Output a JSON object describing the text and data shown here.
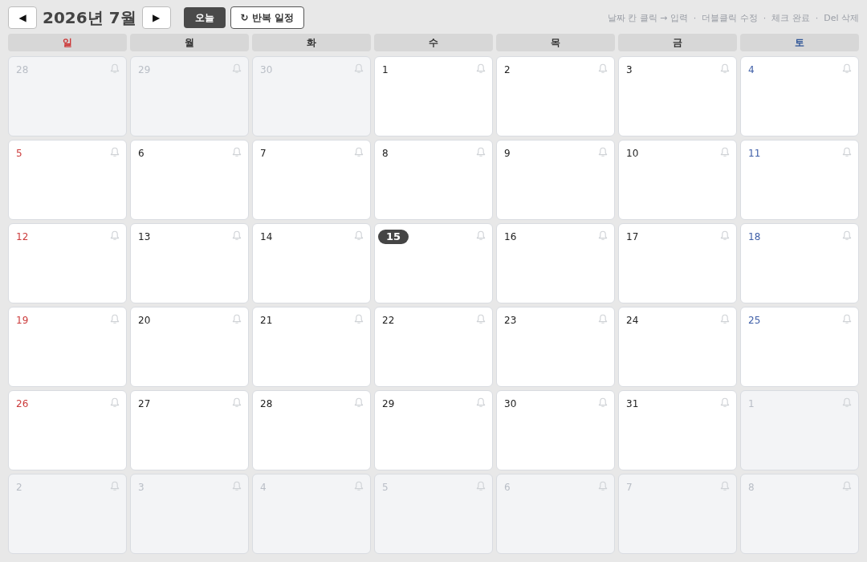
{
  "header": {
    "prev_label": "◀",
    "title": "2026년 7월",
    "next_label": "▶",
    "today_button": "오늘",
    "repeat_button": {
      "icon": "↻",
      "label": "반복 일정"
    },
    "hint": "날짜 칸 클릭 → 입력  ·  더블클릭 수정  ·  체크 완료  ·  Del 삭제"
  },
  "weekdays": [
    {
      "label": "일",
      "kind": "sunday"
    },
    {
      "label": "월",
      "kind": "weekday"
    },
    {
      "label": "화",
      "kind": "weekday"
    },
    {
      "label": "수",
      "kind": "weekday"
    },
    {
      "label": "목",
      "kind": "weekday"
    },
    {
      "label": "금",
      "kind": "weekday"
    },
    {
      "label": "토",
      "kind": "saturday"
    }
  ],
  "weeks": [
    [
      {
        "day": "28",
        "outside": true,
        "today": false
      },
      {
        "day": "29",
        "outside": true,
        "today": false
      },
      {
        "day": "30",
        "outside": true,
        "today": false
      },
      {
        "day": "1",
        "outside": false,
        "today": false
      },
      {
        "day": "2",
        "outside": false,
        "today": false
      },
      {
        "day": "3",
        "outside": false,
        "today": false
      },
      {
        "day": "4",
        "outside": false,
        "today": false
      }
    ],
    [
      {
        "day": "5",
        "outside": false,
        "today": false
      },
      {
        "day": "6",
        "outside": false,
        "today": false
      },
      {
        "day": "7",
        "outside": false,
        "today": false
      },
      {
        "day": "8",
        "outside": false,
        "today": false
      },
      {
        "day": "9",
        "outside": false,
        "today": false
      },
      {
        "day": "10",
        "outside": false,
        "today": false
      },
      {
        "day": "11",
        "outside": false,
        "today": false
      }
    ],
    [
      {
        "day": "12",
        "outside": false,
        "today": false
      },
      {
        "day": "13",
        "outside": false,
        "today": false
      },
      {
        "day": "14",
        "outside": false,
        "today": false
      },
      {
        "day": "15",
        "outside": false,
        "today": true
      },
      {
        "day": "16",
        "outside": false,
        "today": false
      },
      {
        "day": "17",
        "outside": false,
        "today": false
      },
      {
        "day": "18",
        "outside": false,
        "today": false
      }
    ],
    [
      {
        "day": "19",
        "outside": false,
        "today": false
      },
      {
        "day": "20",
        "outside": false,
        "today": false
      },
      {
        "day": "21",
        "outside": false,
        "today": false
      },
      {
        "day": "22",
        "outside": false,
        "today": false
      },
      {
        "day": "23",
        "outside": false,
        "today": false
      },
      {
        "day": "24",
        "outside": false,
        "today": false
      },
      {
        "day": "25",
        "outside": false,
        "today": false
      }
    ],
    [
      {
        "day": "26",
        "outside": false,
        "today": false
      },
      {
        "day": "27",
        "outside": false,
        "today": false
      },
      {
        "day": "28",
        "outside": false,
        "today": false
      },
      {
        "day": "29",
        "outside": false,
        "today": false
      },
      {
        "day": "30",
        "outside": false,
        "today": false
      },
      {
        "day": "31",
        "outside": false,
        "today": false
      },
      {
        "day": "1",
        "outside": true,
        "today": false
      }
    ],
    [
      {
        "day": "2",
        "outside": true,
        "today": false
      },
      {
        "day": "3",
        "outside": true,
        "today": false
      },
      {
        "day": "4",
        "outside": true,
        "today": false
      },
      {
        "day": "5",
        "outside": true,
        "today": false
      },
      {
        "day": "6",
        "outside": true,
        "today": false
      },
      {
        "day": "7",
        "outside": true,
        "today": false
      },
      {
        "day": "8",
        "outside": true,
        "today": false
      }
    ]
  ]
}
